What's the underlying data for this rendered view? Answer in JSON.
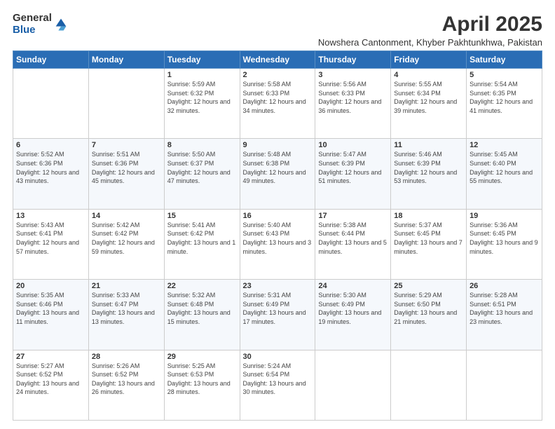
{
  "logo": {
    "general": "General",
    "blue": "Blue"
  },
  "title": "April 2025",
  "subtitle": "Nowshera Cantonment, Khyber Pakhtunkhwa, Pakistan",
  "days_of_week": [
    "Sunday",
    "Monday",
    "Tuesday",
    "Wednesday",
    "Thursday",
    "Friday",
    "Saturday"
  ],
  "weeks": [
    [
      {
        "day": "",
        "info": ""
      },
      {
        "day": "",
        "info": ""
      },
      {
        "day": "1",
        "info": "Sunrise: 5:59 AM\nSunset: 6:32 PM\nDaylight: 12 hours and 32 minutes."
      },
      {
        "day": "2",
        "info": "Sunrise: 5:58 AM\nSunset: 6:33 PM\nDaylight: 12 hours and 34 minutes."
      },
      {
        "day": "3",
        "info": "Sunrise: 5:56 AM\nSunset: 6:33 PM\nDaylight: 12 hours and 36 minutes."
      },
      {
        "day": "4",
        "info": "Sunrise: 5:55 AM\nSunset: 6:34 PM\nDaylight: 12 hours and 39 minutes."
      },
      {
        "day": "5",
        "info": "Sunrise: 5:54 AM\nSunset: 6:35 PM\nDaylight: 12 hours and 41 minutes."
      }
    ],
    [
      {
        "day": "6",
        "info": "Sunrise: 5:52 AM\nSunset: 6:36 PM\nDaylight: 12 hours and 43 minutes."
      },
      {
        "day": "7",
        "info": "Sunrise: 5:51 AM\nSunset: 6:36 PM\nDaylight: 12 hours and 45 minutes."
      },
      {
        "day": "8",
        "info": "Sunrise: 5:50 AM\nSunset: 6:37 PM\nDaylight: 12 hours and 47 minutes."
      },
      {
        "day": "9",
        "info": "Sunrise: 5:48 AM\nSunset: 6:38 PM\nDaylight: 12 hours and 49 minutes."
      },
      {
        "day": "10",
        "info": "Sunrise: 5:47 AM\nSunset: 6:39 PM\nDaylight: 12 hours and 51 minutes."
      },
      {
        "day": "11",
        "info": "Sunrise: 5:46 AM\nSunset: 6:39 PM\nDaylight: 12 hours and 53 minutes."
      },
      {
        "day": "12",
        "info": "Sunrise: 5:45 AM\nSunset: 6:40 PM\nDaylight: 12 hours and 55 minutes."
      }
    ],
    [
      {
        "day": "13",
        "info": "Sunrise: 5:43 AM\nSunset: 6:41 PM\nDaylight: 12 hours and 57 minutes."
      },
      {
        "day": "14",
        "info": "Sunrise: 5:42 AM\nSunset: 6:42 PM\nDaylight: 12 hours and 59 minutes."
      },
      {
        "day": "15",
        "info": "Sunrise: 5:41 AM\nSunset: 6:42 PM\nDaylight: 13 hours and 1 minute."
      },
      {
        "day": "16",
        "info": "Sunrise: 5:40 AM\nSunset: 6:43 PM\nDaylight: 13 hours and 3 minutes."
      },
      {
        "day": "17",
        "info": "Sunrise: 5:38 AM\nSunset: 6:44 PM\nDaylight: 13 hours and 5 minutes."
      },
      {
        "day": "18",
        "info": "Sunrise: 5:37 AM\nSunset: 6:45 PM\nDaylight: 13 hours and 7 minutes."
      },
      {
        "day": "19",
        "info": "Sunrise: 5:36 AM\nSunset: 6:45 PM\nDaylight: 13 hours and 9 minutes."
      }
    ],
    [
      {
        "day": "20",
        "info": "Sunrise: 5:35 AM\nSunset: 6:46 PM\nDaylight: 13 hours and 11 minutes."
      },
      {
        "day": "21",
        "info": "Sunrise: 5:33 AM\nSunset: 6:47 PM\nDaylight: 13 hours and 13 minutes."
      },
      {
        "day": "22",
        "info": "Sunrise: 5:32 AM\nSunset: 6:48 PM\nDaylight: 13 hours and 15 minutes."
      },
      {
        "day": "23",
        "info": "Sunrise: 5:31 AM\nSunset: 6:49 PM\nDaylight: 13 hours and 17 minutes."
      },
      {
        "day": "24",
        "info": "Sunrise: 5:30 AM\nSunset: 6:49 PM\nDaylight: 13 hours and 19 minutes."
      },
      {
        "day": "25",
        "info": "Sunrise: 5:29 AM\nSunset: 6:50 PM\nDaylight: 13 hours and 21 minutes."
      },
      {
        "day": "26",
        "info": "Sunrise: 5:28 AM\nSunset: 6:51 PM\nDaylight: 13 hours and 23 minutes."
      }
    ],
    [
      {
        "day": "27",
        "info": "Sunrise: 5:27 AM\nSunset: 6:52 PM\nDaylight: 13 hours and 24 minutes."
      },
      {
        "day": "28",
        "info": "Sunrise: 5:26 AM\nSunset: 6:52 PM\nDaylight: 13 hours and 26 minutes."
      },
      {
        "day": "29",
        "info": "Sunrise: 5:25 AM\nSunset: 6:53 PM\nDaylight: 13 hours and 28 minutes."
      },
      {
        "day": "30",
        "info": "Sunrise: 5:24 AM\nSunset: 6:54 PM\nDaylight: 13 hours and 30 minutes."
      },
      {
        "day": "",
        "info": ""
      },
      {
        "day": "",
        "info": ""
      },
      {
        "day": "",
        "info": ""
      }
    ]
  ]
}
